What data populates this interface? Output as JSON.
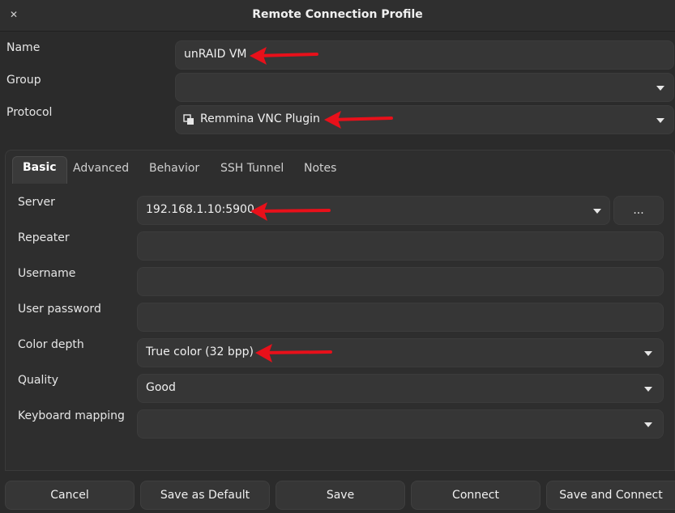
{
  "window": {
    "title": "Remote Connection Profile"
  },
  "profile": {
    "name_label": "Name",
    "name_value": "unRAID VM",
    "group_label": "Group",
    "group_value": "",
    "protocol_label": "Protocol",
    "protocol_value": "Remmina VNC Plugin"
  },
  "tabs": [
    {
      "label": "Basic"
    },
    {
      "label": "Advanced"
    },
    {
      "label": "Behavior"
    },
    {
      "label": "SSH Tunnel"
    },
    {
      "label": "Notes"
    }
  ],
  "basic": {
    "server_label": "Server",
    "server_value": "192.168.1.10:5900",
    "server_more": "...",
    "repeater_label": "Repeater",
    "repeater_value": "",
    "username_label": "Username",
    "username_value": "",
    "password_label": "User password",
    "password_value": "",
    "color_depth_label": "Color depth",
    "color_depth_value": "True color (32 bpp)",
    "quality_label": "Quality",
    "quality_value": "Good",
    "keymap_label": "Keyboard mapping",
    "keymap_value": ""
  },
  "buttons": {
    "cancel": "Cancel",
    "save_default": "Save as Default",
    "save": "Save",
    "connect": "Connect",
    "save_connect": "Save and Connect"
  },
  "colors": {
    "annotation_arrow": "#e8101a",
    "background": "#2b2b2b",
    "field": "#363636"
  }
}
